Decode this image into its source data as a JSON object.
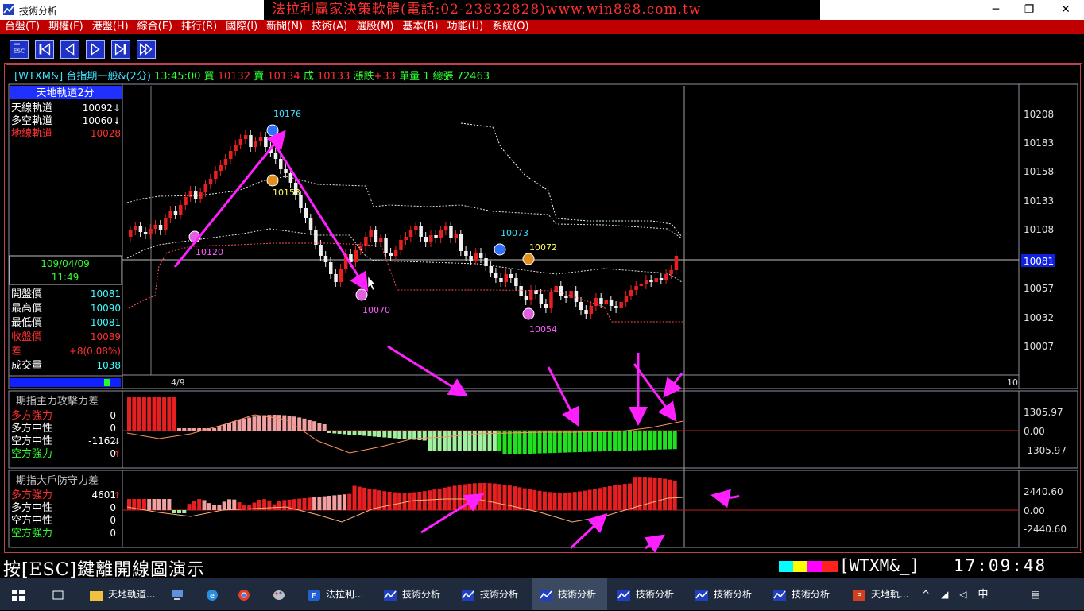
{
  "window": {
    "title": "技術分析",
    "banner": "法拉利贏家決策軟體(電話:02-23832828)www.win888.com.tw",
    "minimize": "─",
    "maximize": "❐",
    "close": "✕"
  },
  "menu": [
    "台盤(T)",
    "期權(F)",
    "港盤(H)",
    "綜合(E)",
    "排行(R)",
    "國際(I)",
    "新聞(N)",
    "技術(A)",
    "選股(M)",
    "基本(B)",
    "功能(U)",
    "系統(O)"
  ],
  "toolbar": [
    "esc",
    "first",
    "prev",
    "next",
    "last",
    "fast-forward"
  ],
  "header": {
    "symbol": "[WTXM&]",
    "name": "台指期一般&(2分)",
    "time": "13:45:00",
    "buy_label": "買",
    "buy": "10132",
    "sell_label": "賣",
    "sell": "10134",
    "deal_label": "成",
    "deal": "10133",
    "change_label": "漲跌",
    "change": "+33",
    "vol_label": "單量",
    "vol": "1",
    "total_label": "總張",
    "total": "72463"
  },
  "side": {
    "indicator_title": "天地軌道2分",
    "tracks": [
      {
        "label": "天線軌道",
        "value": "10092↓",
        "color": "#ffffff"
      },
      {
        "label": "多空軌道",
        "value": "10060↓",
        "color": "#ffffff"
      },
      {
        "label": "地線軌道",
        "value": "10028",
        "color": "#ff3030"
      }
    ],
    "date": "109/04/09",
    "time": "11:49",
    "quotes": [
      {
        "label": "開盤價",
        "value": "10081",
        "color": "#ffffff",
        "vcolor": "#40ffff"
      },
      {
        "label": "最高價",
        "value": "10090",
        "color": "#ffffff",
        "vcolor": "#40ffff"
      },
      {
        "label": "最低價",
        "value": "10081",
        "color": "#ffffff",
        "vcolor": "#40ffff"
      },
      {
        "label": "收盤價",
        "value": "10089",
        "color": "#ff3030",
        "vcolor": "#ff3030"
      },
      {
        "label": "差",
        "value": "+8(0.08%)",
        "color": "#ff3030",
        "vcolor": "#ff3030"
      },
      {
        "label": "成交量",
        "value": "1038",
        "color": "#ffffff",
        "vcolor": "#40ffff"
      }
    ]
  },
  "main_chart": {
    "y_ticks": [
      "10208",
      "10183",
      "10158",
      "10133",
      "10108",
      "10081",
      "10057",
      "10032",
      "10007"
    ],
    "current_price": "10081",
    "x_labels": [
      "4/9",
      "10"
    ],
    "annotations": [
      {
        "text": "10176",
        "color": "#40e0ff"
      },
      {
        "text": "10153",
        "color": "#ffff60"
      },
      {
        "text": "10120",
        "color": "#ff60ff"
      },
      {
        "text": "10070",
        "color": "#ff60ff"
      },
      {
        "text": "10073",
        "color": "#40e0ff"
      },
      {
        "text": "10072",
        "color": "#ffff60"
      },
      {
        "text": "10054",
        "color": "#ff60ff"
      }
    ]
  },
  "panel1": {
    "title": "期指主力攻擊力差",
    "rows": [
      {
        "label": "多方強力",
        "value": "0",
        "color": "#ff3030",
        "arrow": ""
      },
      {
        "label": "多方中性",
        "value": "0",
        "color": "#ffffff",
        "arrow": ""
      },
      {
        "label": "空方中性",
        "value": "-1162",
        "color": "#ffffff",
        "arrow": "↓"
      },
      {
        "label": "空方強力",
        "value": "0",
        "color": "#30ff30",
        "arrow": "↑"
      }
    ],
    "y_ticks": [
      "1305.97",
      "0.00",
      "-1305.97"
    ]
  },
  "panel2": {
    "title": "期指大戶防守力差",
    "rows": [
      {
        "label": "多方強力",
        "value": "4601",
        "color": "#ff3030",
        "arrow": "↑"
      },
      {
        "label": "多方中性",
        "value": "0",
        "color": "#ffffff",
        "arrow": ""
      },
      {
        "label": "空方中性",
        "value": "0",
        "color": "#ffffff",
        "arrow": ""
      },
      {
        "label": "空方強力",
        "value": "0",
        "color": "#30ff30",
        "arrow": ""
      }
    ],
    "y_ticks": [
      "2440.60",
      "0.00",
      "-2440.60"
    ]
  },
  "status": {
    "message": "按[ESC]鍵離開線圖演示",
    "symbol": "[WTXM&_]",
    "clock": "17:09:48"
  },
  "taskbar": [
    {
      "label": "",
      "icon": "start-icon"
    },
    {
      "label": "",
      "icon": "task-view-icon"
    },
    {
      "label": "天地軌道...",
      "icon": "folder-icon"
    },
    {
      "label": "",
      "icon": "computer-icon"
    },
    {
      "label": "",
      "icon": "ie-icon"
    },
    {
      "label": "",
      "icon": "chrome-icon"
    },
    {
      "label": "",
      "icon": "paint-icon"
    },
    {
      "label": "法拉利...",
      "icon": "ferrari-icon"
    },
    {
      "label": "技術分析",
      "icon": "chart-app-icon"
    },
    {
      "label": "技術分析",
      "icon": "chart-app-icon"
    },
    {
      "label": "技術分析",
      "icon": "chart-app-icon"
    },
    {
      "label": "技術分析",
      "icon": "chart-app-icon"
    },
    {
      "label": "技術分析",
      "icon": "chart-app-icon"
    },
    {
      "label": "技術分析",
      "icon": "chart-app-icon"
    },
    {
      "label": "天地軌...",
      "icon": "powerpoint-icon"
    }
  ],
  "tray": {
    "ime": "中"
  },
  "colors": {
    "up": "#e62020",
    "down": "#f0f0f0",
    "bull_light": "#f0a0a0",
    "bear": "#20e020",
    "bear_light": "#a0f0a0",
    "arrow": "#ff20ff",
    "frame": "#c04050",
    "grid": "#d0d0d0"
  }
}
